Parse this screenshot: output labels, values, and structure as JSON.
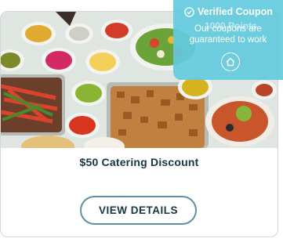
{
  "coupon": {
    "verified_label": "Verified Coupon",
    "points_hidden": "1000 Points",
    "guarantee_text": "Our coupons are guaranteed to work",
    "title": "$50 Catering Discount",
    "button_label": "VIEW DETAILS"
  },
  "icons": {
    "verified": "check-circle-icon",
    "home": "home-icon"
  },
  "colors": {
    "overlay": "#64cade",
    "title": "#143645",
    "button_border": "#5f8fa3"
  }
}
